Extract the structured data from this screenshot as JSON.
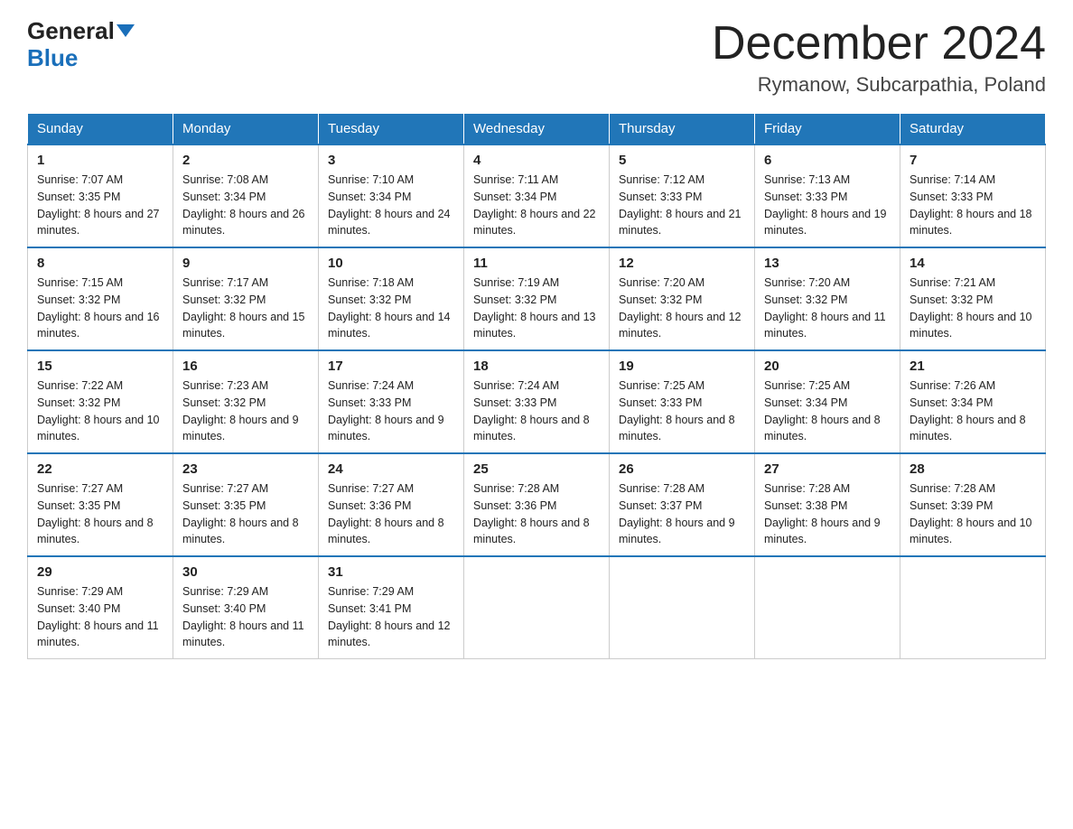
{
  "header": {
    "logo_general": "General",
    "logo_blue": "Blue",
    "month_title": "December 2024",
    "location": "Rymanow, Subcarpathia, Poland"
  },
  "weekdays": [
    "Sunday",
    "Monday",
    "Tuesday",
    "Wednesday",
    "Thursday",
    "Friday",
    "Saturday"
  ],
  "weeks": [
    [
      {
        "day": "1",
        "sunrise": "7:07 AM",
        "sunset": "3:35 PM",
        "daylight": "8 hours and 27 minutes."
      },
      {
        "day": "2",
        "sunrise": "7:08 AM",
        "sunset": "3:34 PM",
        "daylight": "8 hours and 26 minutes."
      },
      {
        "day": "3",
        "sunrise": "7:10 AM",
        "sunset": "3:34 PM",
        "daylight": "8 hours and 24 minutes."
      },
      {
        "day": "4",
        "sunrise": "7:11 AM",
        "sunset": "3:34 PM",
        "daylight": "8 hours and 22 minutes."
      },
      {
        "day": "5",
        "sunrise": "7:12 AM",
        "sunset": "3:33 PM",
        "daylight": "8 hours and 21 minutes."
      },
      {
        "day": "6",
        "sunrise": "7:13 AM",
        "sunset": "3:33 PM",
        "daylight": "8 hours and 19 minutes."
      },
      {
        "day": "7",
        "sunrise": "7:14 AM",
        "sunset": "3:33 PM",
        "daylight": "8 hours and 18 minutes."
      }
    ],
    [
      {
        "day": "8",
        "sunrise": "7:15 AM",
        "sunset": "3:32 PM",
        "daylight": "8 hours and 16 minutes."
      },
      {
        "day": "9",
        "sunrise": "7:17 AM",
        "sunset": "3:32 PM",
        "daylight": "8 hours and 15 minutes."
      },
      {
        "day": "10",
        "sunrise": "7:18 AM",
        "sunset": "3:32 PM",
        "daylight": "8 hours and 14 minutes."
      },
      {
        "day": "11",
        "sunrise": "7:19 AM",
        "sunset": "3:32 PM",
        "daylight": "8 hours and 13 minutes."
      },
      {
        "day": "12",
        "sunrise": "7:20 AM",
        "sunset": "3:32 PM",
        "daylight": "8 hours and 12 minutes."
      },
      {
        "day": "13",
        "sunrise": "7:20 AM",
        "sunset": "3:32 PM",
        "daylight": "8 hours and 11 minutes."
      },
      {
        "day": "14",
        "sunrise": "7:21 AM",
        "sunset": "3:32 PM",
        "daylight": "8 hours and 10 minutes."
      }
    ],
    [
      {
        "day": "15",
        "sunrise": "7:22 AM",
        "sunset": "3:32 PM",
        "daylight": "8 hours and 10 minutes."
      },
      {
        "day": "16",
        "sunrise": "7:23 AM",
        "sunset": "3:32 PM",
        "daylight": "8 hours and 9 minutes."
      },
      {
        "day": "17",
        "sunrise": "7:24 AM",
        "sunset": "3:33 PM",
        "daylight": "8 hours and 9 minutes."
      },
      {
        "day": "18",
        "sunrise": "7:24 AM",
        "sunset": "3:33 PM",
        "daylight": "8 hours and 8 minutes."
      },
      {
        "day": "19",
        "sunrise": "7:25 AM",
        "sunset": "3:33 PM",
        "daylight": "8 hours and 8 minutes."
      },
      {
        "day": "20",
        "sunrise": "7:25 AM",
        "sunset": "3:34 PM",
        "daylight": "8 hours and 8 minutes."
      },
      {
        "day": "21",
        "sunrise": "7:26 AM",
        "sunset": "3:34 PM",
        "daylight": "8 hours and 8 minutes."
      }
    ],
    [
      {
        "day": "22",
        "sunrise": "7:27 AM",
        "sunset": "3:35 PM",
        "daylight": "8 hours and 8 minutes."
      },
      {
        "day": "23",
        "sunrise": "7:27 AM",
        "sunset": "3:35 PM",
        "daylight": "8 hours and 8 minutes."
      },
      {
        "day": "24",
        "sunrise": "7:27 AM",
        "sunset": "3:36 PM",
        "daylight": "8 hours and 8 minutes."
      },
      {
        "day": "25",
        "sunrise": "7:28 AM",
        "sunset": "3:36 PM",
        "daylight": "8 hours and 8 minutes."
      },
      {
        "day": "26",
        "sunrise": "7:28 AM",
        "sunset": "3:37 PM",
        "daylight": "8 hours and 9 minutes."
      },
      {
        "day": "27",
        "sunrise": "7:28 AM",
        "sunset": "3:38 PM",
        "daylight": "8 hours and 9 minutes."
      },
      {
        "day": "28",
        "sunrise": "7:28 AM",
        "sunset": "3:39 PM",
        "daylight": "8 hours and 10 minutes."
      }
    ],
    [
      {
        "day": "29",
        "sunrise": "7:29 AM",
        "sunset": "3:40 PM",
        "daylight": "8 hours and 11 minutes."
      },
      {
        "day": "30",
        "sunrise": "7:29 AM",
        "sunset": "3:40 PM",
        "daylight": "8 hours and 11 minutes."
      },
      {
        "day": "31",
        "sunrise": "7:29 AM",
        "sunset": "3:41 PM",
        "daylight": "8 hours and 12 minutes."
      },
      null,
      null,
      null,
      null
    ]
  ]
}
